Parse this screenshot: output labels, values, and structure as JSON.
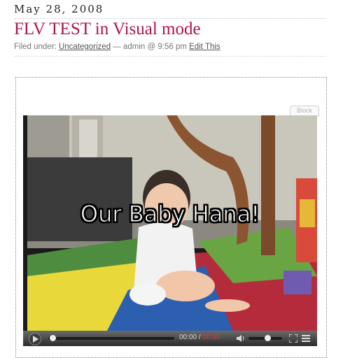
{
  "post": {
    "date": "May 28, 2008",
    "title": "FLV TEST in Visual mode",
    "meta": {
      "prefix": "Filed under:",
      "category": "Uncategorized",
      "author_time": "— admin @ 9:56 pm",
      "edit_link": "Edit This"
    }
  },
  "editor": {
    "block_label": "Block"
  },
  "player": {
    "caption": "Our Baby Hana!",
    "current_time": "00:00",
    "separator": "/",
    "duration": "00:00",
    "progress": 0,
    "volume": 0.6,
    "duration_color": "#e23b3b"
  },
  "icons": [
    "play-icon",
    "volume-icon",
    "fullscreen-icon",
    "menu-icon"
  ],
  "colors": {
    "title": "#b0154b",
    "meta_text": "#777777"
  }
}
